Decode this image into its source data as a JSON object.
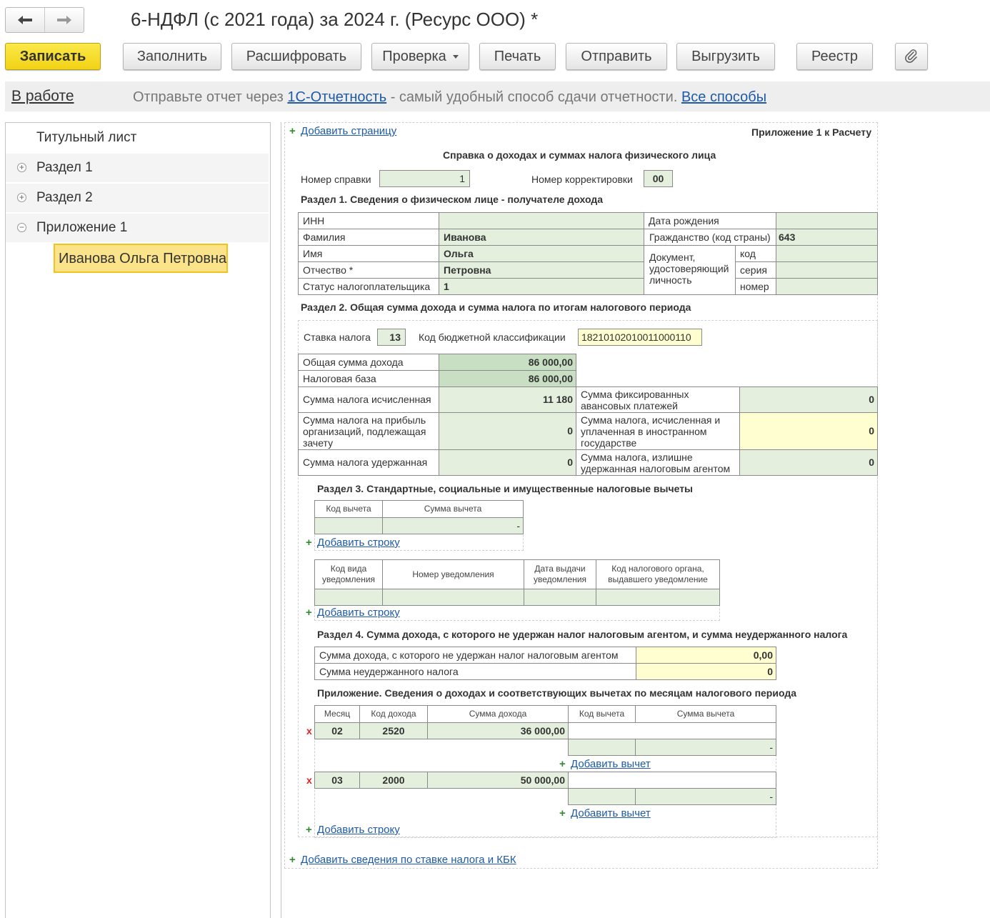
{
  "window": {
    "title": "6-НДФЛ (с 2021 года) за 2024 г. (Ресурс ООО) *"
  },
  "toolbar": {
    "save": "Записать",
    "fill": "Заполнить",
    "decode": "Расшифровать",
    "check": "Проверка",
    "print": "Печать",
    "send": "Отправить",
    "export": "Выгрузить",
    "registry": "Реестр",
    "attach_icon": "paperclip-icon"
  },
  "infobar": {
    "status": "В работе",
    "text_before": "Отправьте отчет через ",
    "link1": "1С-Отчетность",
    "text_after": " - самый удобный способ сдачи отчетности. ",
    "link2": "Все способы"
  },
  "tree": {
    "items": [
      {
        "label": "Титульный лист"
      },
      {
        "label": "Раздел 1",
        "toggle": "+"
      },
      {
        "label": "Раздел 2",
        "toggle": "+"
      },
      {
        "label": "Приложение 1",
        "toggle": "−"
      }
    ],
    "selected": "Иванова Ольга Петровна"
  },
  "form": {
    "add_page": "Добавить страницу",
    "appendix_label": "Приложение 1 к Расчету",
    "title": "Справка о доходах и суммах налога физического лица",
    "cert_number_label": "Номер справки",
    "cert_number": "1",
    "correction_label": "Номер корректировки",
    "correction": "00",
    "section1": {
      "title": "Раздел 1. Сведения о физическом лице - получателе дохода",
      "inn_label": "ИНН",
      "inn": "",
      "lastname_label": "Фамилия",
      "lastname": "Иванова",
      "firstname_label": "Имя",
      "firstname": "Ольга",
      "patronymic_label": "Отчество *",
      "patronymic": "Петровна",
      "status_label": "Статус налогоплательщика",
      "status": "1",
      "birth_label": "Дата рождения",
      "birth": "",
      "citizenship_label": "Гражданство (код страны)",
      "citizenship": "643",
      "doc_label": "Документ, удостоверяющий личность",
      "doc_code_label": "код",
      "doc_code": "",
      "doc_series_label": "серия",
      "doc_series": "",
      "doc_number_label": "номер",
      "doc_number": ""
    },
    "section2": {
      "title": "Раздел 2. Общая сумма дохода и сумма налога по итогам налогового периода",
      "rate_label": "Ставка налога",
      "rate": "13",
      "kbk_label": "Код бюджетной классификации",
      "kbk": "18210102010011000110",
      "total_income_label": "Общая сумма дохода",
      "total_income": "86 000,00",
      "tax_base_label": "Налоговая база",
      "tax_base": "86 000,00",
      "tax_calc_label": "Сумма налога исчисленная",
      "tax_calc": "11 180",
      "fixed_adv_label": "Сумма фиксированных авансовых платежей",
      "fixed_adv": "0",
      "profit_tax_label": "Сумма налога на прибыль организаций, подлежащая зачету",
      "profit_tax": "0",
      "foreign_tax_label": "Сумма налога, исчисленная и уплаченная в иностранном государстве",
      "foreign_tax": "0",
      "withheld_label": "Сумма налога удержанная",
      "withheld": "0",
      "excess_label": "Сумма налога, излишне удержанная налоговым агентом",
      "excess": "0"
    },
    "section3": {
      "title": "Раздел 3. Стандартные, социальные и имущественные налоговые вычеты",
      "col_code": "Код вычета",
      "col_sum": "Сумма вычета",
      "rows": [
        {
          "code": "",
          "sum": "-"
        }
      ],
      "add_row": "Добавить строку",
      "notif_cols": [
        "Код вида уведомления",
        "Номер уведомления",
        "Дата выдачи уведомления",
        "Код налогового органа, выдавшего уведомление"
      ],
      "add_row2": "Добавить строку"
    },
    "section4": {
      "title": "Раздел 4. Сумма дохода, с которого не удержан налог налоговым агентом, и сумма неудержанного налога",
      "unwithheld_income_label": "Сумма дохода, с которого не удержан налог налоговым агентом",
      "unwithheld_income": "0,00",
      "unwithheld_tax_label": "Сумма неудержанного налога",
      "unwithheld_tax": "0"
    },
    "appendix": {
      "title": "Приложение. Сведения о доходах и соответствующих вычетах по месяцам налогового периода",
      "cols": [
        "Месяц",
        "Код дохода",
        "Сумма дохода",
        "Код вычета",
        "Сумма вычета"
      ],
      "rows": [
        {
          "month": "02",
          "code": "2520",
          "sum": "36 000,00",
          "ded_code": "",
          "ded_sum": "-"
        },
        {
          "month": "03",
          "code": "2000",
          "sum": "50 000,00",
          "ded_code": "",
          "ded_sum": "-"
        }
      ],
      "delete_mark": "x",
      "add_deduction": "Добавить вычет",
      "add_row": "Добавить строку"
    },
    "add_rate_kbk": "Добавить сведения по ставке налога и КБК"
  },
  "colors": {
    "accent_yellow": "#f2d214",
    "field_green": "#e4efdd",
    "field_yellow": "#fefed0",
    "link": "#1f5aa6"
  }
}
